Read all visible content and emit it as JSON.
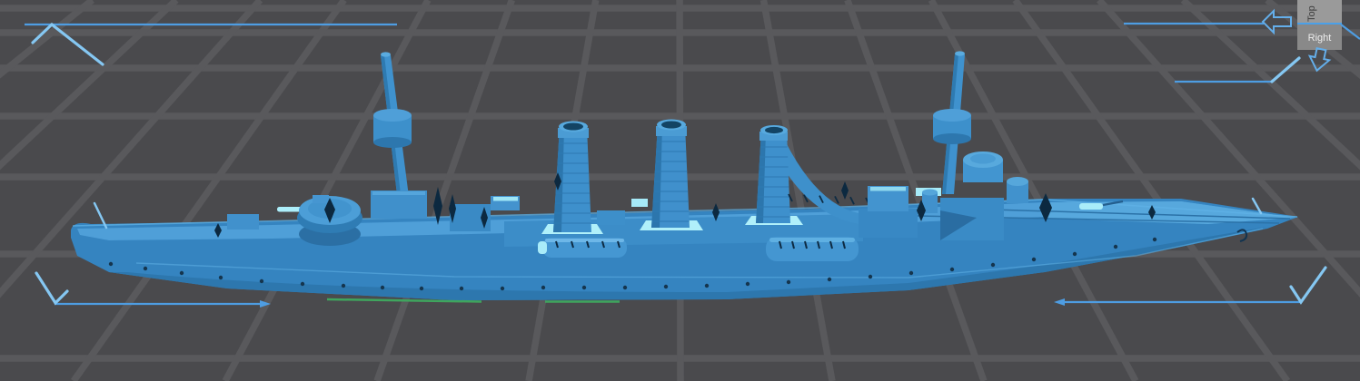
{
  "viewport": {
    "type": "3d-model-viewer",
    "content_description": "Blue 3D-printable warship model (cruiser with three funnels and two masts) selected on a dark perspective build-plate grid"
  },
  "view_cube": {
    "front_face_label": "Right",
    "top_face_label": "Top"
  },
  "model": {
    "name": "warship model",
    "selected": true
  },
  "colors": {
    "background": "#4a4a4d",
    "grid_line": "#59595c",
    "model_blue": "#3584c0",
    "model_deck": "#4f9fd8",
    "model_highlight": "#aceefa",
    "model_shadow": "#0c2940",
    "selection_blue": "#4e9de2",
    "selection_bracket": "#85c7f2",
    "contact_green": "#3fa55e",
    "cube_top_face": "#9a9a9a",
    "cube_front_face": "#898989",
    "cube_edge_blue": "#4aa0e8",
    "cube_top_label_color": "#3d3d3d",
    "cube_front_label_color": "#ededed"
  }
}
